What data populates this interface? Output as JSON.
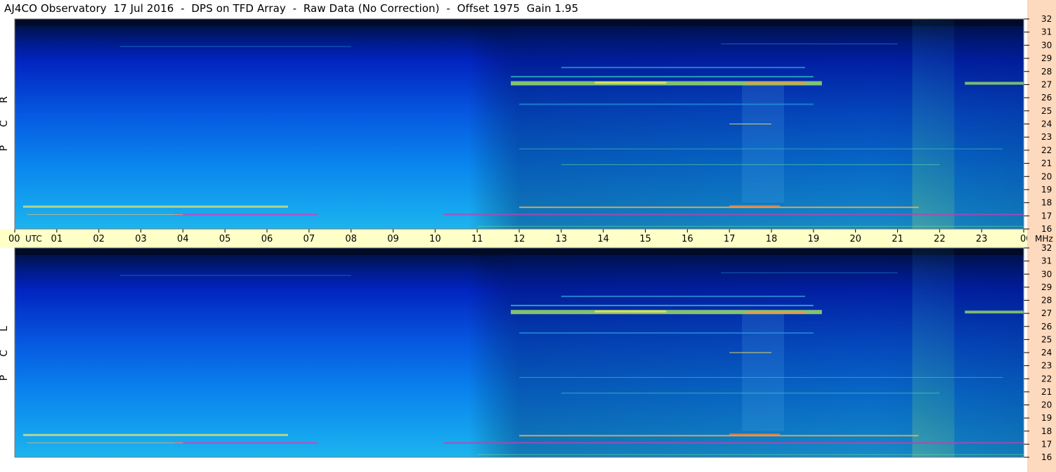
{
  "title": "AJ4CO Observatory  17 Jul 2016  -  DPS on TFD Array  -  Raw Data (No Correction)  -  Offset 1975  Gain 1.95",
  "chart_data": [
    {
      "type": "heatmap",
      "panel_label": [
        "R",
        "C",
        "P"
      ],
      "y_ticks": [
        16,
        17,
        18,
        19,
        20,
        21,
        22,
        23,
        24,
        25,
        26,
        27,
        28,
        29,
        30,
        31,
        32
      ],
      "ylim": [
        16,
        32
      ],
      "time_ticks": [
        "00",
        "01",
        "02",
        "03",
        "04",
        "05",
        "06",
        "07",
        "08",
        "09",
        "10",
        "11",
        "12",
        "13",
        "14",
        "15",
        "16",
        "17",
        "18",
        "19",
        "20",
        "21",
        "22",
        "23",
        "00"
      ],
      "xlim_hours": [
        0,
        24
      ]
    },
    {
      "type": "heatmap",
      "panel_label": [
        "L",
        "C",
        "P"
      ],
      "y_ticks": [
        16,
        17,
        18,
        19,
        20,
        21,
        22,
        23,
        24,
        25,
        26,
        27,
        28,
        29,
        30,
        31,
        32
      ],
      "ylim": [
        16,
        32
      ],
      "time_ticks": [
        "00",
        "01",
        "02",
        "03",
        "04",
        "05",
        "06",
        "07",
        "08",
        "09",
        "10",
        "11",
        "12",
        "13",
        "14",
        "15",
        "16",
        "17",
        "18",
        "19",
        "20",
        "21",
        "22",
        "23",
        "00"
      ],
      "xlim_hours": [
        0,
        24
      ]
    }
  ],
  "axis": {
    "time_unit": "UTC",
    "freq_unit": "MHz"
  },
  "colors": {
    "sky_top": "#000e2e",
    "deep_blue": "#0322c8",
    "mid_blue": "#0a6fe8",
    "cyan": "#1aa8f0",
    "green": "#4be38a",
    "yellow": "#dfe87a",
    "band_bg": "#ffffc8",
    "scale_bg": "#fdd9bd"
  }
}
